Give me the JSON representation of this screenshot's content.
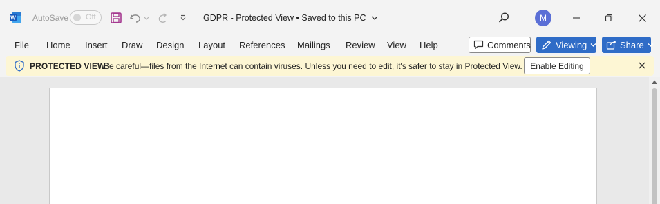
{
  "titlebar": {
    "autosave_label": "AutoSave",
    "autosave_state": "Off",
    "doc_title": "GDPR  -  Protected View • Saved to this PC",
    "avatar_initial": "M",
    "icons": [
      "word-logo-icon",
      "save-icon",
      "undo-icon",
      "redo-icon",
      "customize-qat-icon",
      "search-icon",
      "minimize-icon",
      "restore-icon",
      "close-icon"
    ]
  },
  "ribbon": {
    "tabs": [
      "File",
      "Home",
      "Insert",
      "Draw",
      "Design",
      "Layout",
      "References",
      "Mailings",
      "Review",
      "View",
      "Help"
    ],
    "comments_label": "Comments",
    "viewing_label": "Viewing",
    "share_label": "Share"
  },
  "protected_bar": {
    "title": "PROTECTED VIEW",
    "message": "Be careful—files from the Internet can contain viruses. Unless you need to edit, it's safer to stay in Protected View.",
    "enable_label": "Enable Editing"
  },
  "colors": {
    "accent": "#2f6cc7",
    "warning_bar": "#fdf6d4",
    "avatar": "#5b6fd6",
    "save_icon": "#a4378f"
  }
}
